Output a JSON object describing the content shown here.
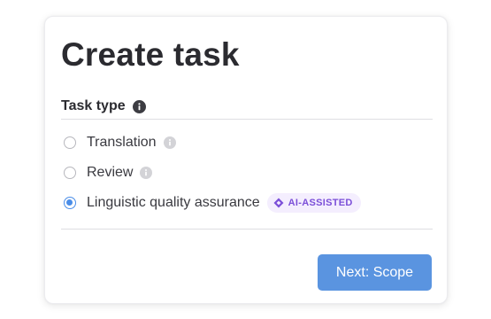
{
  "dialog": {
    "title": "Create task",
    "section_label": "Task type",
    "options": [
      {
        "label": "Translation",
        "selected": false,
        "has_info": true
      },
      {
        "label": "Review",
        "selected": false,
        "has_info": true
      },
      {
        "label": "Linguistic quality assurance",
        "selected": true,
        "badge": "AI-ASSISTED"
      }
    ],
    "next_button": "Next: Scope"
  },
  "colors": {
    "primary": "#5a94e0",
    "radio_selected": "#4a8de8",
    "badge_text": "#7b4fd8",
    "badge_bg": "#f4eefe"
  },
  "icons": {
    "section_info": "info-icon",
    "option_info": "info-icon",
    "badge": "ai-sparkle-icon"
  }
}
